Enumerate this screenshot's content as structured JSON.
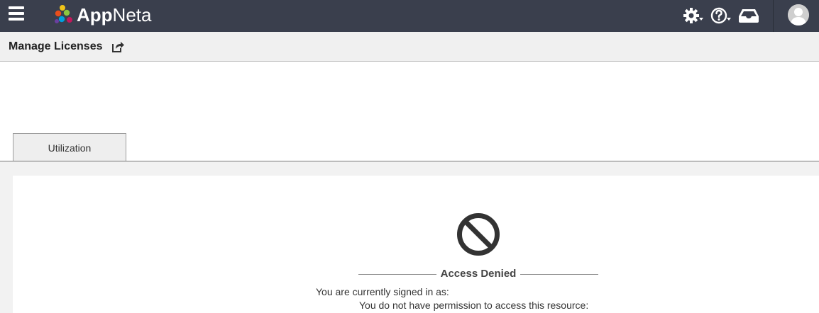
{
  "app": {
    "logo_text_bold": "App",
    "logo_text_light": "Neta"
  },
  "header": {
    "icons": [
      "menu-icon",
      "gear-icon",
      "help-icon",
      "inbox-icon",
      "avatar"
    ]
  },
  "subheader": {
    "title": "Manage Licenses"
  },
  "tabs": [
    {
      "label": "Utilization"
    }
  ],
  "message": {
    "title": "Access Denied",
    "signed_in": "You are currently signed in as:",
    "no_permission": "You do not have permission to access this resource:"
  },
  "colors": {
    "topbar": "#3a3f4d",
    "subheader": "#f0f0f0",
    "content_bg": "#f2f2f2",
    "denied_icon": "#333333"
  }
}
